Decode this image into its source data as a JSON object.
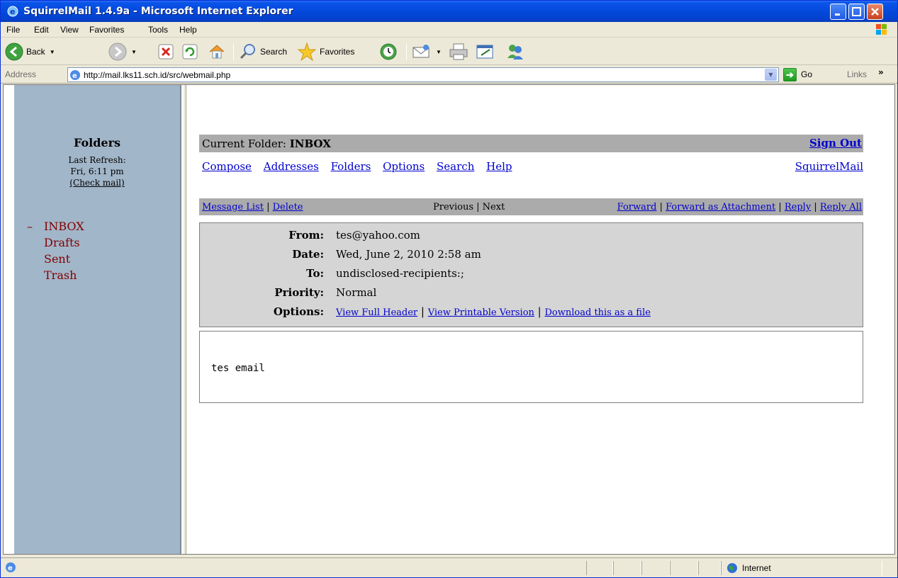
{
  "window": {
    "title": "SquirrelMail 1.4.9a - Microsoft Internet Explorer"
  },
  "menubar": {
    "items": [
      "File",
      "Edit",
      "View",
      "Favorites",
      "Tools",
      "Help"
    ]
  },
  "toolbar": {
    "back_label": "Back",
    "search_label": "Search",
    "favorites_label": "Favorites"
  },
  "addressbar": {
    "label": "Address",
    "url": "http://mail.lks11.sch.id/src/webmail.php",
    "go_label": "Go",
    "links_label": "Links"
  },
  "sidebar": {
    "title": "Folders",
    "last_refresh_label": "Last Refresh:",
    "last_refresh_time": "Fri, 6:11 pm",
    "check_mail": "(Check mail)",
    "folders": [
      "INBOX",
      "Drafts",
      "Sent",
      "Trash"
    ],
    "expander": "–"
  },
  "main": {
    "current_folder_label": "Current Folder:",
    "current_folder": "INBOX",
    "sign_out": "Sign Out",
    "nav": [
      "Compose",
      "Addresses",
      "Folders",
      "Options",
      "Search",
      "Help"
    ],
    "brand_link": "SquirrelMail",
    "msgbar": {
      "message_list": "Message List",
      "delete": "Delete",
      "previous_next": "Previous | Next",
      "forward": "Forward",
      "forward_attachment": "Forward as Attachment",
      "reply": "Reply",
      "reply_all": "Reply All"
    },
    "header": {
      "from_label": "From:",
      "from": "tes@yahoo.com",
      "date_label": "Date:",
      "date": "Wed, June 2, 2010 2:58 am",
      "to_label": "To:",
      "to": "undisclosed-recipients:;",
      "priority_label": "Priority:",
      "priority": "Normal",
      "options_label": "Options:",
      "view_full_header": "View Full Header",
      "view_printable": "View Printable Version",
      "download": "Download this as a file"
    },
    "body": "tes email"
  },
  "statusbar": {
    "zone": "Internet"
  },
  "colors": {
    "titlebar": "#0349db",
    "sidebar_bg": "#a2b6c9",
    "folder_color": "#800000",
    "link_color": "#0000cc",
    "bar_gray": "#ababab",
    "header_bg": "#d5d5d5"
  }
}
